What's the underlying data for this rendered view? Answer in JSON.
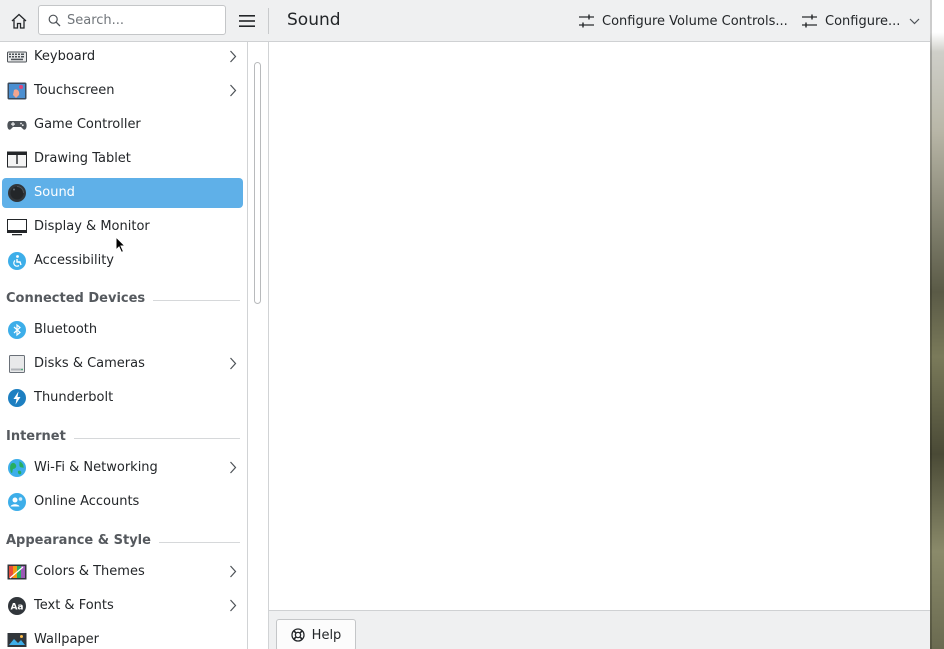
{
  "toolbar": {
    "search_placeholder": "Search...",
    "page_title": "Sound",
    "configure_volume_label": "Configure Volume Controls...",
    "configure_label": "Configure..."
  },
  "sidebar": {
    "items": [
      {
        "label": "Keyboard",
        "icon": "keyboard-icon",
        "has_children": true
      },
      {
        "label": "Touchscreen",
        "icon": "touchscreen-icon",
        "has_children": true
      },
      {
        "label": "Game Controller",
        "icon": "game-controller-icon",
        "has_children": false
      },
      {
        "label": "Drawing Tablet",
        "icon": "drawing-tablet-icon",
        "has_children": false
      },
      {
        "label": "Sound",
        "icon": "sound-icon",
        "has_children": false,
        "selected": true
      },
      {
        "label": "Display & Monitor",
        "icon": "display-monitor-icon",
        "has_children": false
      },
      {
        "label": "Accessibility",
        "icon": "accessibility-icon",
        "has_children": false
      }
    ],
    "sections": [
      {
        "title": "Connected Devices",
        "items": [
          {
            "label": "Bluetooth",
            "icon": "bluetooth-icon",
            "has_children": false
          },
          {
            "label": "Disks & Cameras",
            "icon": "disks-cameras-icon",
            "has_children": true
          },
          {
            "label": "Thunderbolt",
            "icon": "thunderbolt-icon",
            "has_children": false
          }
        ]
      },
      {
        "title": "Internet",
        "items": [
          {
            "label": "Wi-Fi & Networking",
            "icon": "wifi-networking-icon",
            "has_children": true
          },
          {
            "label": "Online Accounts",
            "icon": "online-accounts-icon",
            "has_children": false
          }
        ]
      },
      {
        "title": "Appearance & Style",
        "items": [
          {
            "label": "Colors & Themes",
            "icon": "colors-themes-icon",
            "has_children": true
          },
          {
            "label": "Text & Fonts",
            "icon": "text-fonts-icon",
            "has_children": true
          },
          {
            "label": "Wallpaper",
            "icon": "wallpaper-icon",
            "has_children": false
          }
        ]
      }
    ]
  },
  "footer": {
    "help_label": "Help"
  },
  "colors": {
    "selection": "#5fb0e8",
    "toolbar_bg": "#eff0f1",
    "text": "#232629",
    "section_text": "#55595e"
  }
}
